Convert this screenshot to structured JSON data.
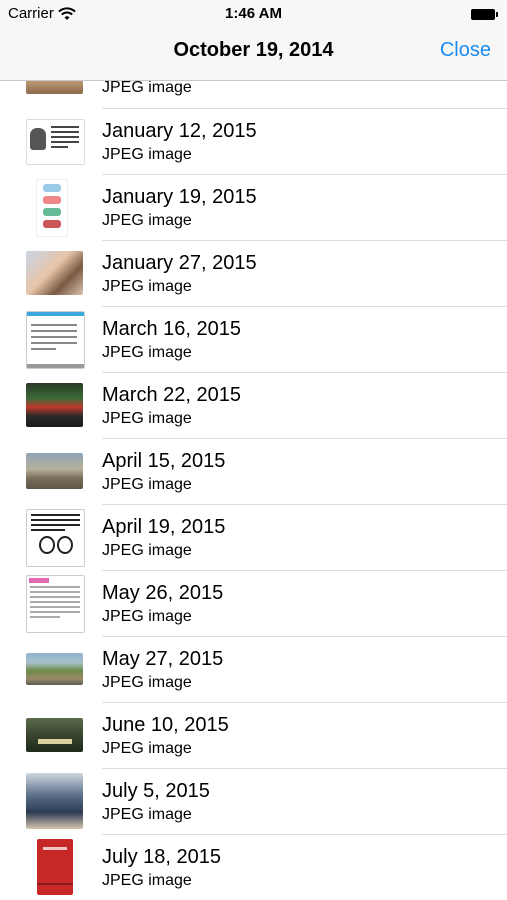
{
  "status_bar": {
    "carrier": "Carrier",
    "time": "1:46 AM"
  },
  "nav": {
    "title": "October 19, 2014",
    "close_label": "Close"
  },
  "colors": {
    "accent": "#1a8cf0"
  },
  "files": [
    {
      "name": "",
      "kind": "JPEG image",
      "thumb": "photo-thumbnail"
    },
    {
      "name": "January 12, 2015",
      "kind": "JPEG image",
      "thumb": "quote-thumbnail"
    },
    {
      "name": "January 19, 2015",
      "kind": "JPEG image",
      "thumb": "comic-thumbnail"
    },
    {
      "name": "January 27, 2015",
      "kind": "JPEG image",
      "thumb": "selfie-thumbnail"
    },
    {
      "name": "March 16, 2015",
      "kind": "JPEG image",
      "thumb": "text-post-thumbnail"
    },
    {
      "name": "March 22, 2015",
      "kind": "JPEG image",
      "thumb": "street-thumbnail"
    },
    {
      "name": "April 15, 2015",
      "kind": "JPEG image",
      "thumb": "city-thumbnail"
    },
    {
      "name": "April 19, 2015",
      "kind": "JPEG image",
      "thumb": "meme-thumbnail"
    },
    {
      "name": "May 26, 2015",
      "kind": "JPEG image",
      "thumb": "article-thumbnail"
    },
    {
      "name": "May 27, 2015",
      "kind": "JPEG image",
      "thumb": "road-thumbnail"
    },
    {
      "name": "June 10, 2015",
      "kind": "JPEG image",
      "thumb": "poster-thumbnail"
    },
    {
      "name": "July 5, 2015",
      "kind": "JPEG image",
      "thumb": "person-thumbnail"
    },
    {
      "name": "July 18, 2015",
      "kind": "JPEG image",
      "thumb": "book-thumbnail"
    }
  ]
}
